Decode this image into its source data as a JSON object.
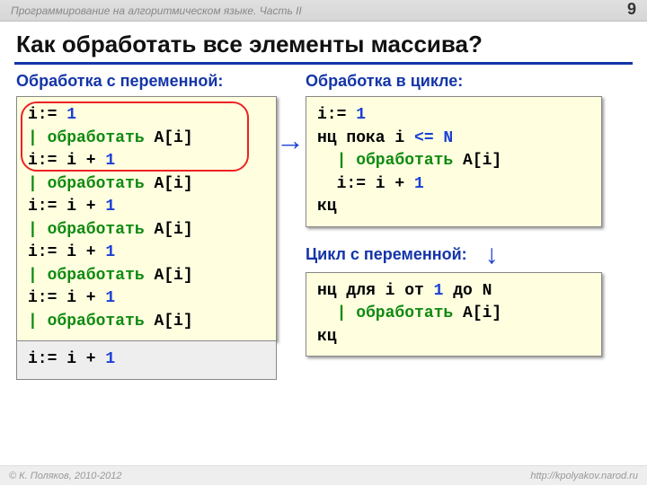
{
  "header": {
    "course": "Программирование на алгоритмическом языке. Часть II",
    "page": "9"
  },
  "title": "Как обработать все элементы массива?",
  "sections": {
    "variable": "Обработка с переменной:",
    "loop": "Обработка в цикле:",
    "forloop": "Цикл с переменной:"
  },
  "code": {
    "left": {
      "l1a": "i:= ",
      "l1b": "1",
      "l2a": "| обработать ",
      "l2b": "A[i]",
      "l3a": "i:= i + ",
      "l3b": "1",
      "l4a": "| обработать ",
      "l4b": "A[i]",
      "l5a": "i:= i + ",
      "l5b": "1",
      "l6a": "| обработать ",
      "l6b": "A[i]",
      "l7a": "i:= i + ",
      "l7b": "1",
      "l8a": "| обработать ",
      "l8b": "A[i]",
      "l9a": "i:= i + ",
      "l9b": "1",
      "l10a": "| обработать ",
      "l10b": "A[i]"
    },
    "leftExtra": {
      "a": "i:= i + ",
      "b": "1"
    },
    "loop": {
      "l1a": "i:= ",
      "l1b": "1",
      "l2a": "нц пока",
      "l2b": " i ",
      "l2c": "<= N",
      "l3a": "  | обработать ",
      "l3b": "A[i]",
      "l4a": "  i:= i + ",
      "l4b": "1",
      "l5": "кц"
    },
    "for": {
      "l1a": "нц для",
      "l1b": " i ",
      "l1c": "от ",
      "l1d": "1",
      "l1e": " до N",
      "l2a": "  | обработать ",
      "l2b": "A[i]",
      "l3": "кц"
    }
  },
  "footer": {
    "left": "© К. Поляков, 2010-2012",
    "right": "http://kpolyakov.narod.ru"
  }
}
